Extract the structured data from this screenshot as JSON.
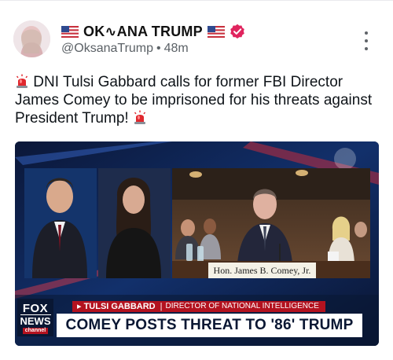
{
  "author": {
    "display_name": "OK∿ANA TRUMP",
    "handle": "@OksanaTrump",
    "time_ago": "48m",
    "verified": true
  },
  "icons": {
    "leading_flag": "us-flag-icon",
    "trailing_flag": "us-flag-icon",
    "verified": "verified-badge-icon",
    "more": "more-vertical-icon",
    "emoji": "police-siren-icon"
  },
  "post": {
    "text": "DNI Tulsi Gabbard calls for former FBI Director James Comey to be imprisoned for his threats against President Trump!"
  },
  "media": {
    "nameplate": "Hon. James B. Comey, Jr.",
    "chyron_tag": "▸ TULSI GABBARD",
    "chyron_subtitle": "DIRECTOR OF NATIONAL INTELLIGENCE",
    "chyron_headline": "COMEY POSTS THREAT TO '86' TRUMP",
    "logo_text_top": "FOX",
    "logo_text_mid": "NEWS",
    "logo_text_bottom": "channel"
  },
  "colors": {
    "verified_badge": "#e0245e",
    "fox_red": "#b3121f",
    "fox_navy": "#0a1733",
    "siren_red": "#e0282e"
  }
}
